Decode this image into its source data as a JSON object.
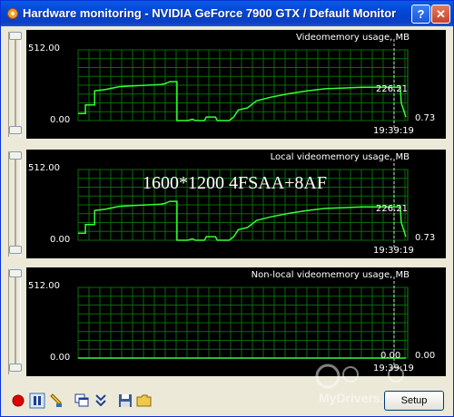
{
  "window": {
    "title": "Hardware monitoring - NVIDIA GeForce 7900 GTX / Default Monitor"
  },
  "overlay_text": "1600*1200  4FSAA+8AF",
  "panels": [
    {
      "name": "Videomemory usage, MB",
      "y_max_label": "512.00",
      "y_min_label": "0.00",
      "current_label": "226.21",
      "last_label": "0.73",
      "time_label": "19:39:19",
      "line_color": "#33ff33",
      "series": [
        [
          0,
          10
        ],
        [
          8,
          10
        ],
        [
          8,
          22
        ],
        [
          18,
          22
        ],
        [
          18,
          42
        ],
        [
          30,
          44
        ],
        [
          45,
          48
        ],
        [
          60,
          49
        ],
        [
          75,
          50
        ],
        [
          90,
          51
        ],
        [
          95,
          52
        ],
        [
          100,
          55
        ],
        [
          108,
          55
        ],
        [
          108,
          0
        ],
        [
          120,
          0
        ],
        [
          125,
          2
        ],
        [
          128,
          0
        ],
        [
          138,
          0
        ],
        [
          140,
          5
        ],
        [
          150,
          5
        ],
        [
          152,
          0
        ],
        [
          165,
          0
        ],
        [
          170,
          5
        ],
        [
          175,
          15
        ],
        [
          185,
          18
        ],
        [
          195,
          28
        ],
        [
          210,
          33
        ],
        [
          230,
          38
        ],
        [
          250,
          42
        ],
        [
          270,
          45
        ],
        [
          290,
          46
        ],
        [
          310,
          47
        ],
        [
          330,
          47
        ],
        [
          352,
          47
        ],
        [
          353,
          25
        ],
        [
          358,
          5
        ]
      ]
    },
    {
      "name": "Local videomemory usage, MB",
      "y_max_label": "512.00",
      "y_min_label": "0.00",
      "current_label": "226.21",
      "last_label": "0.73",
      "time_label": "19:39:19",
      "line_color": "#33ff33",
      "series": [
        [
          0,
          10
        ],
        [
          8,
          10
        ],
        [
          8,
          22
        ],
        [
          18,
          22
        ],
        [
          18,
          42
        ],
        [
          30,
          44
        ],
        [
          45,
          48
        ],
        [
          60,
          49
        ],
        [
          75,
          50
        ],
        [
          90,
          51
        ],
        [
          95,
          52
        ],
        [
          100,
          55
        ],
        [
          108,
          55
        ],
        [
          108,
          0
        ],
        [
          120,
          0
        ],
        [
          125,
          2
        ],
        [
          128,
          0
        ],
        [
          138,
          0
        ],
        [
          140,
          5
        ],
        [
          150,
          5
        ],
        [
          152,
          0
        ],
        [
          165,
          0
        ],
        [
          170,
          5
        ],
        [
          175,
          15
        ],
        [
          185,
          18
        ],
        [
          195,
          28
        ],
        [
          210,
          33
        ],
        [
          230,
          38
        ],
        [
          250,
          42
        ],
        [
          270,
          45
        ],
        [
          290,
          46
        ],
        [
          310,
          47
        ],
        [
          330,
          47
        ],
        [
          352,
          47
        ],
        [
          353,
          25
        ],
        [
          358,
          5
        ]
      ]
    },
    {
      "name": "Non-local videomemory usage, MB",
      "y_max_label": "512.00",
      "y_min_label": "0.00",
      "current_label": "0.00",
      "last_label": "0.00",
      "time_label": "19:39:19",
      "line_color": "#33ff33",
      "series": [
        [
          0,
          0
        ],
        [
          358,
          0
        ]
      ]
    }
  ],
  "toolbar": {
    "setup_label": "Setup",
    "icons": [
      "record-icon",
      "pause-icon",
      "properties-icon",
      "windows-icon",
      "collapse-icon",
      "save-icon",
      "open-icon"
    ]
  },
  "watermark_text": "MyDrivers.com"
}
